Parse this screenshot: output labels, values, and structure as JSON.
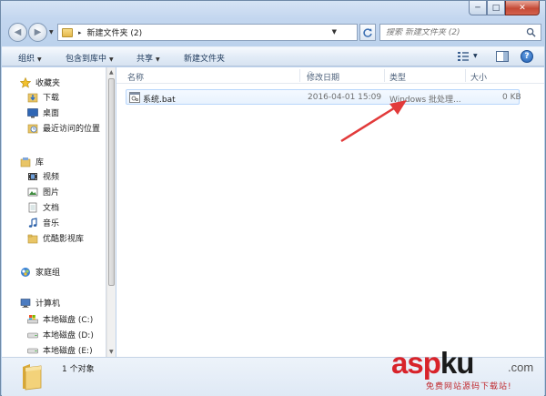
{
  "window": {
    "caption": {
      "minimize": "─",
      "maximize": "□",
      "close": "✕"
    }
  },
  "navigation": {
    "back": "◀",
    "forward": "▶",
    "path_separator": "▸",
    "path": "新建文件夹 (2)",
    "search_placeholder": "搜索 新建文件夹 (2)"
  },
  "toolbar": {
    "organize": "组织",
    "include_in_library": "包含到库中",
    "share": "共享",
    "new_folder": "新建文件夹",
    "help": "?"
  },
  "sidebar": {
    "favorites": {
      "label": "收藏夹",
      "items": [
        "下载",
        "桌面",
        "最近访问的位置"
      ]
    },
    "libraries": {
      "label": "库",
      "items": [
        "视频",
        "图片",
        "文档",
        "音乐",
        "优酷影视库"
      ]
    },
    "homegroup": {
      "label": "家庭组"
    },
    "computer": {
      "label": "计算机",
      "items": [
        "本地磁盘 (C:)",
        "本地磁盘 (D:)",
        "本地磁盘 (E:)"
      ]
    }
  },
  "columns": {
    "name": "名称",
    "modified": "修改日期",
    "type": "类型",
    "size": "大小"
  },
  "files": [
    {
      "name": "系统.bat",
      "modified": "2016-04-01 15:09",
      "type": "Windows 批处理...",
      "size": "0 KB"
    }
  ],
  "status": {
    "item_count": "1 个对象"
  },
  "watermark": {
    "asp": "asp",
    "ku": "ku",
    "com": ".com",
    "sub": "免费网站源码下载站!"
  },
  "colors": {
    "accent_arrow": "#e23a3a",
    "selection_border": "#b8d6fb",
    "folder_yellow": "#e5b84a"
  }
}
